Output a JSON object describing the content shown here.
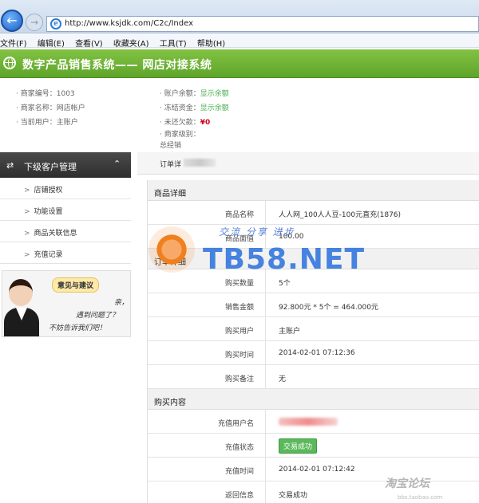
{
  "browser": {
    "url": "http://www.ksjdk.com/C2c/Index",
    "menus": [
      "文件(F)",
      "编辑(E)",
      "查看(V)",
      "收藏夹(A)",
      "工具(T)",
      "帮助(H)"
    ]
  },
  "header": {
    "title": "数字产品销售系统—— 网店对接系统"
  },
  "info": {
    "merchant_no_label": "商家编号：",
    "merchant_no": "1003",
    "merchant_name_label": "商家名称：",
    "merchant_name": "网店帐户",
    "current_user_label": "当前用户：",
    "current_user": "主账户",
    "balance_label": "账户余额：",
    "balance": "显示余额",
    "frozen_label": "冻结资金：",
    "frozen": "显示余额",
    "debt_label": "未还欠款：",
    "debt": "¥0",
    "level_label": "商家级别：",
    "level_sub": "总经销"
  },
  "sidebar": {
    "title": "下级客户管理",
    "items": [
      "店铺授权",
      "功能设置",
      "商品关联信息",
      "充值记录"
    ],
    "feedback": {
      "title": "意见与建议",
      "line1": "亲，",
      "line2": "遇到问题了？",
      "line3": "不妨告诉我们吧！"
    }
  },
  "tab": {
    "title": "订单详"
  },
  "sections": {
    "goods": {
      "title": "商品详细",
      "name_label": "商品名称",
      "name_value": "人人网_100人人豆-100元直充(1876)",
      "face_label": "商品面值",
      "face_value": "100.00"
    },
    "order": {
      "title": "订单详细",
      "qty_label": "购买数量",
      "qty_value": "5个",
      "amount_label": "销售金额",
      "amount_value": "92.800元 * 5个 = 464.000元",
      "user_label": "购买用户",
      "user_value": "主账户",
      "time_label": "购买时间",
      "time_value": "2014-02-01 07:12:36",
      "note_label": "购买备注",
      "note_value": "无"
    },
    "purchase": {
      "title": "购买内容",
      "account_label": "充值用户名",
      "status_label": "充值状态",
      "status_value": "交易成功",
      "recharge_time_label": "充值时间",
      "recharge_time_value": "2014-02-01 07:12:42",
      "return_label": "返回信息",
      "return_value": "交易成功"
    }
  },
  "watermark": {
    "slogan": "交流 分享 进步",
    "text": "TB58.NET",
    "corner": "淘宝论坛",
    "corner_sub": "bbs.taobao.com"
  }
}
